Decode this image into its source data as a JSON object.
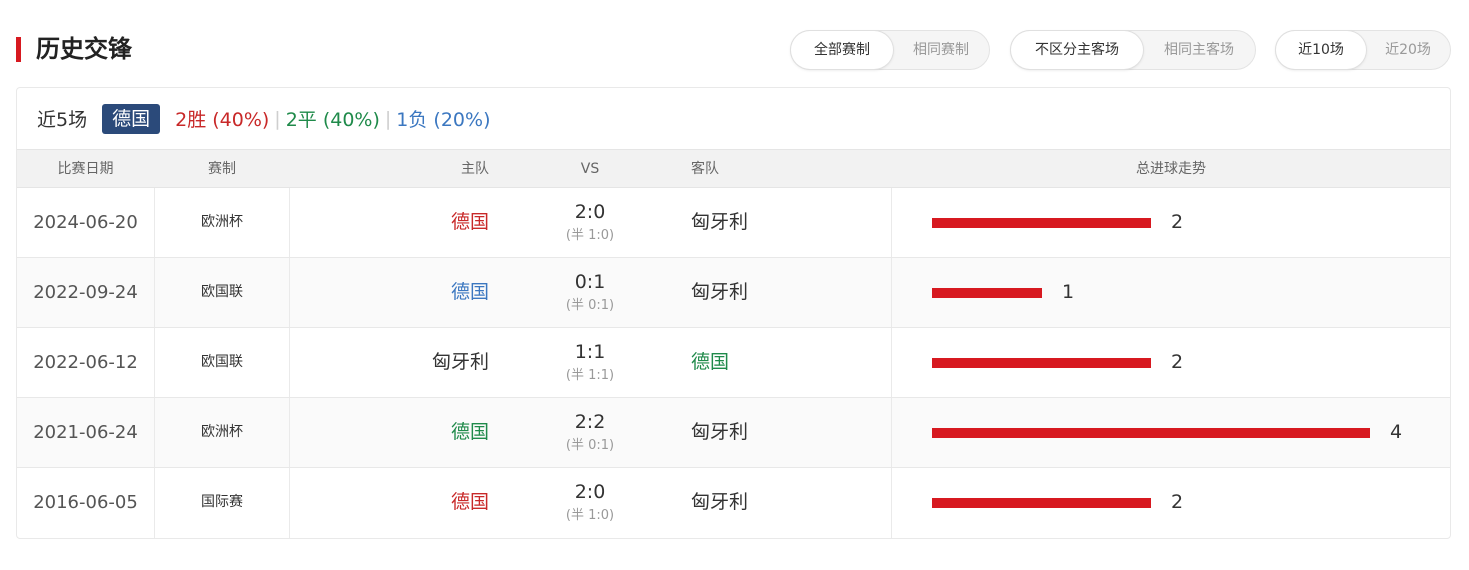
{
  "header": {
    "title": "历史交锋"
  },
  "filters": {
    "competition": [
      "全部赛制",
      "相同赛制"
    ],
    "venue": [
      "不区分主客场",
      "相同主客场"
    ],
    "range": [
      "近10场",
      "近20场"
    ]
  },
  "summary": {
    "label": "近5场",
    "team": "德国",
    "win": "2胜 (40%)",
    "draw": "2平 (40%)",
    "loss": "1负 (20%)",
    "sep": "|"
  },
  "columns": {
    "date": "比赛日期",
    "competition": "赛制",
    "home": "主队",
    "vs": "VS",
    "away": "客队",
    "trend": "总进球走势"
  },
  "trend_max": 4,
  "matches": [
    {
      "date": "2024-06-20",
      "competition": "欧洲杯",
      "home": "德国",
      "home_result": "win",
      "score": "2:0",
      "half": "(半 1:0)",
      "away": "匈牙利",
      "away_result": "plain",
      "total": 2,
      "total_label": "2"
    },
    {
      "date": "2022-09-24",
      "competition": "欧国联",
      "home": "德国",
      "home_result": "loss",
      "score": "0:1",
      "half": "(半 0:1)",
      "away": "匈牙利",
      "away_result": "plain",
      "total": 1,
      "total_label": "1"
    },
    {
      "date": "2022-06-12",
      "competition": "欧国联",
      "home": "匈牙利",
      "home_result": "plain",
      "score": "1:1",
      "half": "(半 1:1)",
      "away": "德国",
      "away_result": "draw",
      "total": 2,
      "total_label": "2"
    },
    {
      "date": "2021-06-24",
      "competition": "欧洲杯",
      "home": "德国",
      "home_result": "draw",
      "score": "2:2",
      "half": "(半 0:1)",
      "away": "匈牙利",
      "away_result": "plain",
      "total": 4,
      "total_label": "4"
    },
    {
      "date": "2016-06-05",
      "competition": "国际赛",
      "home": "德国",
      "home_result": "win",
      "score": "2:0",
      "half": "(半 1:0)",
      "away": "匈牙利",
      "away_result": "plain",
      "total": 2,
      "total_label": "2"
    }
  ],
  "colors": {
    "accent": "#d71920",
    "win": "#c82828",
    "draw": "#1f8a4a",
    "loss": "#3b77c0",
    "badge": "#2b4a7a"
  }
}
